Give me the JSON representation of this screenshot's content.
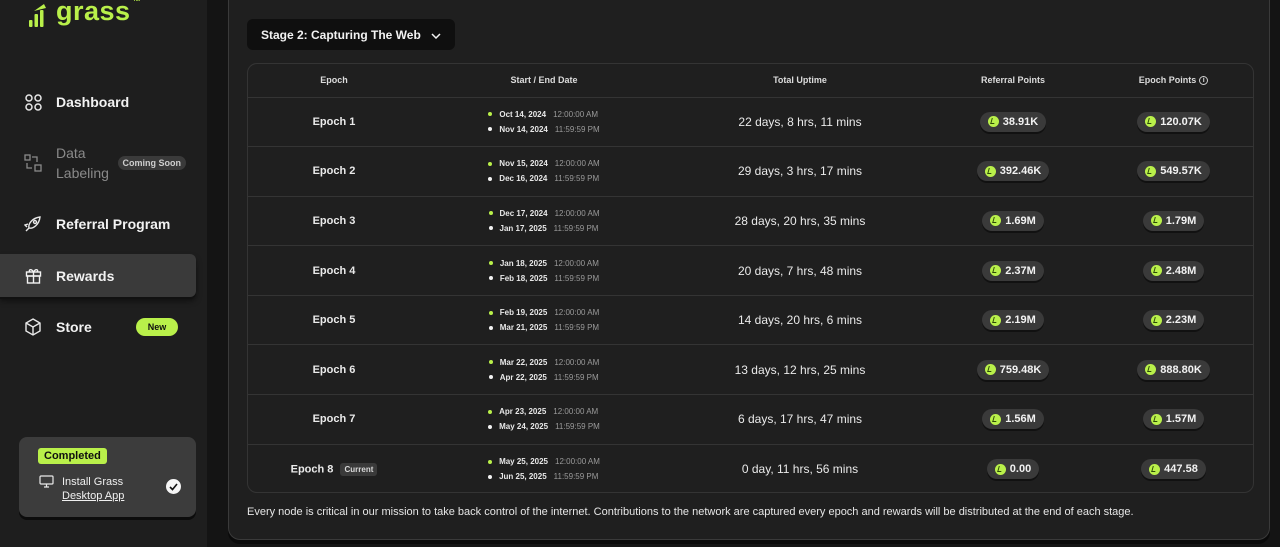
{
  "brand": {
    "name": "grass",
    "tm": "™",
    "accent": "#b9f04a"
  },
  "sidebar": {
    "items": [
      {
        "label": "Dashboard",
        "icon": "dashboard-grid-icon"
      },
      {
        "label": "Data\nLabeling",
        "line1": "Data",
        "line2": "Labeling",
        "badge": "Coming Soon",
        "icon": "data-labeling-icon"
      },
      {
        "label": "Referral Program",
        "icon": "rocket-icon"
      },
      {
        "label": "Rewards",
        "icon": "gift-icon"
      },
      {
        "label": "Store",
        "badge": "New",
        "icon": "cube-icon"
      }
    ],
    "completed_card": {
      "badge": "Completed",
      "line1": "Install Grass",
      "link": "Desktop App",
      "checked": true
    }
  },
  "stage_selector": {
    "label": "Stage 2: Capturing The Web"
  },
  "table": {
    "columns": [
      "Epoch",
      "Start / End Date",
      "Total Uptime",
      "Referral Points",
      "Epoch Points"
    ],
    "rows": [
      {
        "epoch": "Epoch 1",
        "start_date": "Oct 14, 2024",
        "start_time": "12:00:00 AM",
        "end_date": "Nov 14, 2024",
        "end_time": "11:59:59 PM",
        "uptime": "22 days, 8 hrs, 11 mins",
        "referral": "38.91K",
        "epoch_points": "120.07K"
      },
      {
        "epoch": "Epoch 2",
        "start_date": "Nov 15, 2024",
        "start_time": "12:00:00 AM",
        "end_date": "Dec 16, 2024",
        "end_time": "11:59:59 PM",
        "uptime": "29 days, 3 hrs, 17 mins",
        "referral": "392.46K",
        "epoch_points": "549.57K"
      },
      {
        "epoch": "Epoch 3",
        "start_date": "Dec 17, 2024",
        "start_time": "12:00:00 AM",
        "end_date": "Jan 17, 2025",
        "end_time": "11:59:59 PM",
        "uptime": "28 days, 20 hrs, 35 mins",
        "referral": "1.69M",
        "epoch_points": "1.79M"
      },
      {
        "epoch": "Epoch 4",
        "start_date": "Jan 18, 2025",
        "start_time": "12:00:00 AM",
        "end_date": "Feb 18, 2025",
        "end_time": "11:59:59 PM",
        "uptime": "20 days, 7 hrs, 48 mins",
        "referral": "2.37M",
        "epoch_points": "2.48M"
      },
      {
        "epoch": "Epoch 5",
        "start_date": "Feb 19, 2025",
        "start_time": "12:00:00 AM",
        "end_date": "Mar 21, 2025",
        "end_time": "11:59:59 PM",
        "uptime": "14 days, 20 hrs, 6 mins",
        "referral": "2.19M",
        "epoch_points": "2.23M"
      },
      {
        "epoch": "Epoch 6",
        "start_date": "Mar 22, 2025",
        "start_time": "12:00:00 AM",
        "end_date": "Apr 22, 2025",
        "end_time": "11:59:59 PM",
        "uptime": "13 days, 12 hrs, 25 mins",
        "referral": "759.48K",
        "epoch_points": "888.80K"
      },
      {
        "epoch": "Epoch 7",
        "start_date": "Apr 23, 2025",
        "start_time": "12:00:00 AM",
        "end_date": "May 24, 2025",
        "end_time": "11:59:59 PM",
        "uptime": "6 days, 17 hrs, 47 mins",
        "referral": "1.56M",
        "epoch_points": "1.57M"
      },
      {
        "epoch": "Epoch 8",
        "current_tag": "Current",
        "start_date": "May 25, 2025",
        "start_time": "12:00:00 AM",
        "end_date": "Jun 25, 2025",
        "end_time": "11:59:59 PM",
        "uptime": "0 day, 11 hrs, 56 mins",
        "referral": "0.00",
        "epoch_points": "447.58"
      }
    ]
  },
  "footnote": "Every node is critical in our mission to take back control of the internet. Contributions to the network are captured every epoch and rewards will be distributed at the end of each stage."
}
